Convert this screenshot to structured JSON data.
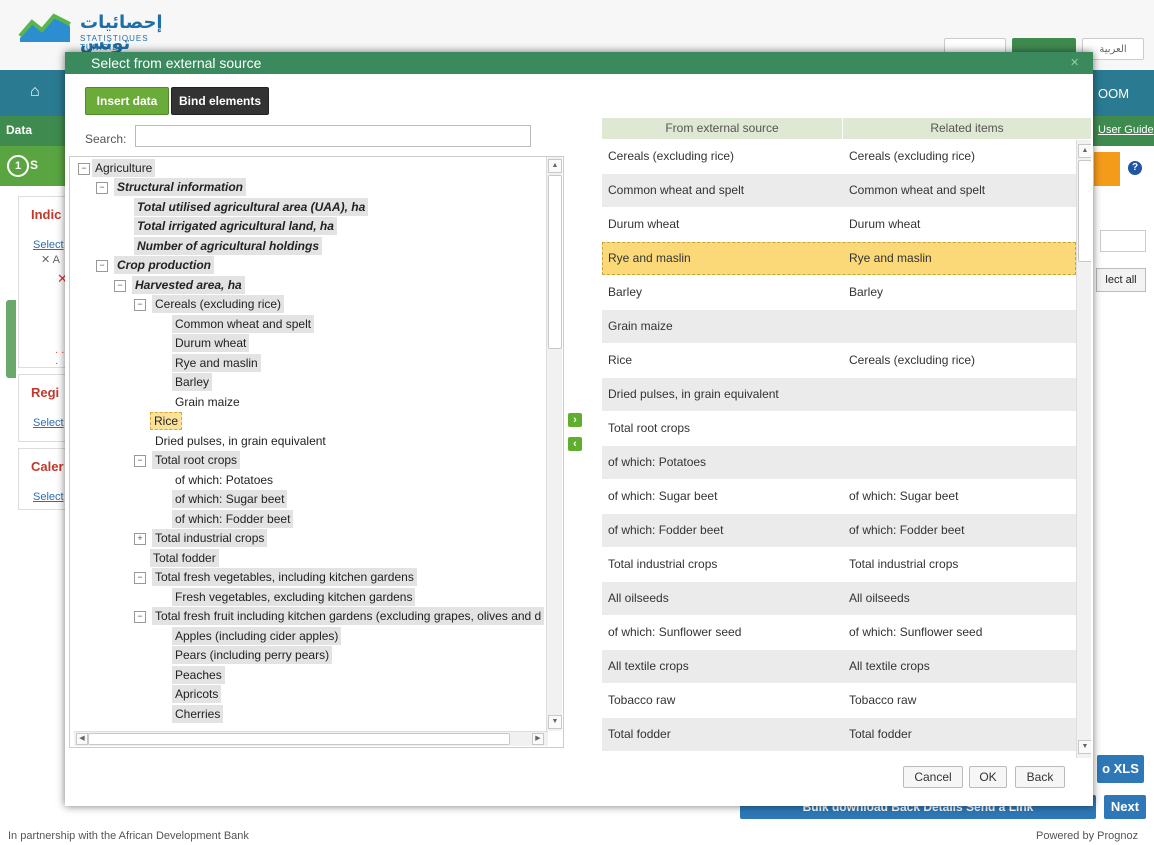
{
  "background": {
    "logo": {
      "arabic": "إحصائيات تونس",
      "latin": "STATISTIQUES TUNISIE"
    },
    "lang": {
      "arabic": "العربية"
    },
    "nav_right": "OOM",
    "subnav": {
      "data": "Data",
      "user_guide": "User Guide"
    },
    "step": {
      "number": "1",
      "letter": "S"
    },
    "panels": [
      {
        "title": "Indic",
        "link": "Select"
      },
      {
        "title": "Regi",
        "link": "Select"
      },
      {
        "title": "Caler",
        "link": "Select"
      }
    ],
    "indic_items": [
      "✕ A",
      "✕"
    ],
    "dots": "· · ·",
    "select_all": "lect all",
    "export_xls": "o XLS",
    "bottom_buttons": "Bulk download   Back   Details   Send a Link",
    "next": "Next",
    "footer_left": "In partnership with the African Development Bank",
    "footer_right": "Powered by Prognoz"
  },
  "dialog": {
    "title": "Select from external source",
    "close_glyph": "✕",
    "insert_label": "Insert data",
    "bind_label": "Bind elements",
    "search_label": "Search:",
    "search_value": "",
    "tree": [
      {
        "label": "Agriculture",
        "toggle": "−"
      },
      {
        "label": "Structural information",
        "toggle": "−"
      },
      {
        "label": "Total utilised agricultural area (UAA), ha"
      },
      {
        "label": "Total irrigated agricultural land, ha"
      },
      {
        "label": "Number of agricultural holdings"
      },
      {
        "label": "Crop production",
        "toggle": "−"
      },
      {
        "label": "Harvested area, ha",
        "toggle": "−"
      },
      {
        "label": "Cereals (excluding rice)",
        "toggle": "−"
      },
      {
        "label": "Common wheat and spelt"
      },
      {
        "label": "Durum wheat"
      },
      {
        "label": "Rye and maslin"
      },
      {
        "label": "Barley"
      },
      {
        "label": "Grain maize"
      },
      {
        "label": "Rice"
      },
      {
        "label": "Dried pulses, in grain equivalent"
      },
      {
        "label": "Total root crops",
        "toggle": "−"
      },
      {
        "label": "of which: Potatoes"
      },
      {
        "label": "of which: Sugar beet"
      },
      {
        "label": "of which: Fodder beet"
      },
      {
        "label": "Total industrial crops",
        "toggle": "+"
      },
      {
        "label": "Total fodder"
      },
      {
        "label": "Total fresh vegetables, including kitchen gardens",
        "toggle": "−"
      },
      {
        "label": "Fresh vegetables, excluding kitchen gardens"
      },
      {
        "label": "Total fresh fruit including kitchen gardens (excluding grapes, olives and d",
        "toggle": "−"
      },
      {
        "label": "Apples (including cider apples)"
      },
      {
        "label": "Pears (including perry pears)"
      },
      {
        "label": "Peaches"
      },
      {
        "label": "Apricots"
      },
      {
        "label": "Cherries"
      }
    ],
    "move_right": "›",
    "move_left": "‹",
    "table": {
      "headers": [
        "From external source",
        "Related items"
      ],
      "rows": [
        [
          "Cereals (excluding rice)",
          "Cereals (excluding rice)"
        ],
        [
          "Common wheat and spelt",
          "Common wheat and spelt"
        ],
        [
          "Durum wheat",
          "Durum wheat"
        ],
        [
          "Rye and maslin",
          "Rye and maslin"
        ],
        [
          "Barley",
          "Barley"
        ],
        [
          "Grain maize",
          ""
        ],
        [
          "Rice",
          "Cereals (excluding rice)"
        ],
        [
          "Dried pulses, in grain equivalent",
          ""
        ],
        [
          "Total root crops",
          ""
        ],
        [
          "of which: Potatoes",
          ""
        ],
        [
          "of which: Sugar beet",
          "of which: Sugar beet"
        ],
        [
          "of which: Fodder beet",
          "of which: Fodder beet"
        ],
        [
          "Total industrial crops",
          "Total industrial crops"
        ],
        [
          "All oilseeds",
          "All oilseeds"
        ],
        [
          "of which: Sunflower seed",
          "of which: Sunflower seed"
        ],
        [
          "All textile crops",
          "All textile crops"
        ],
        [
          "Tobacco raw",
          "Tobacco raw"
        ],
        [
          "Total fodder",
          "Total fodder"
        ]
      ]
    },
    "buttons": {
      "cancel": "Cancel",
      "ok": "OK",
      "back": "Back"
    }
  }
}
